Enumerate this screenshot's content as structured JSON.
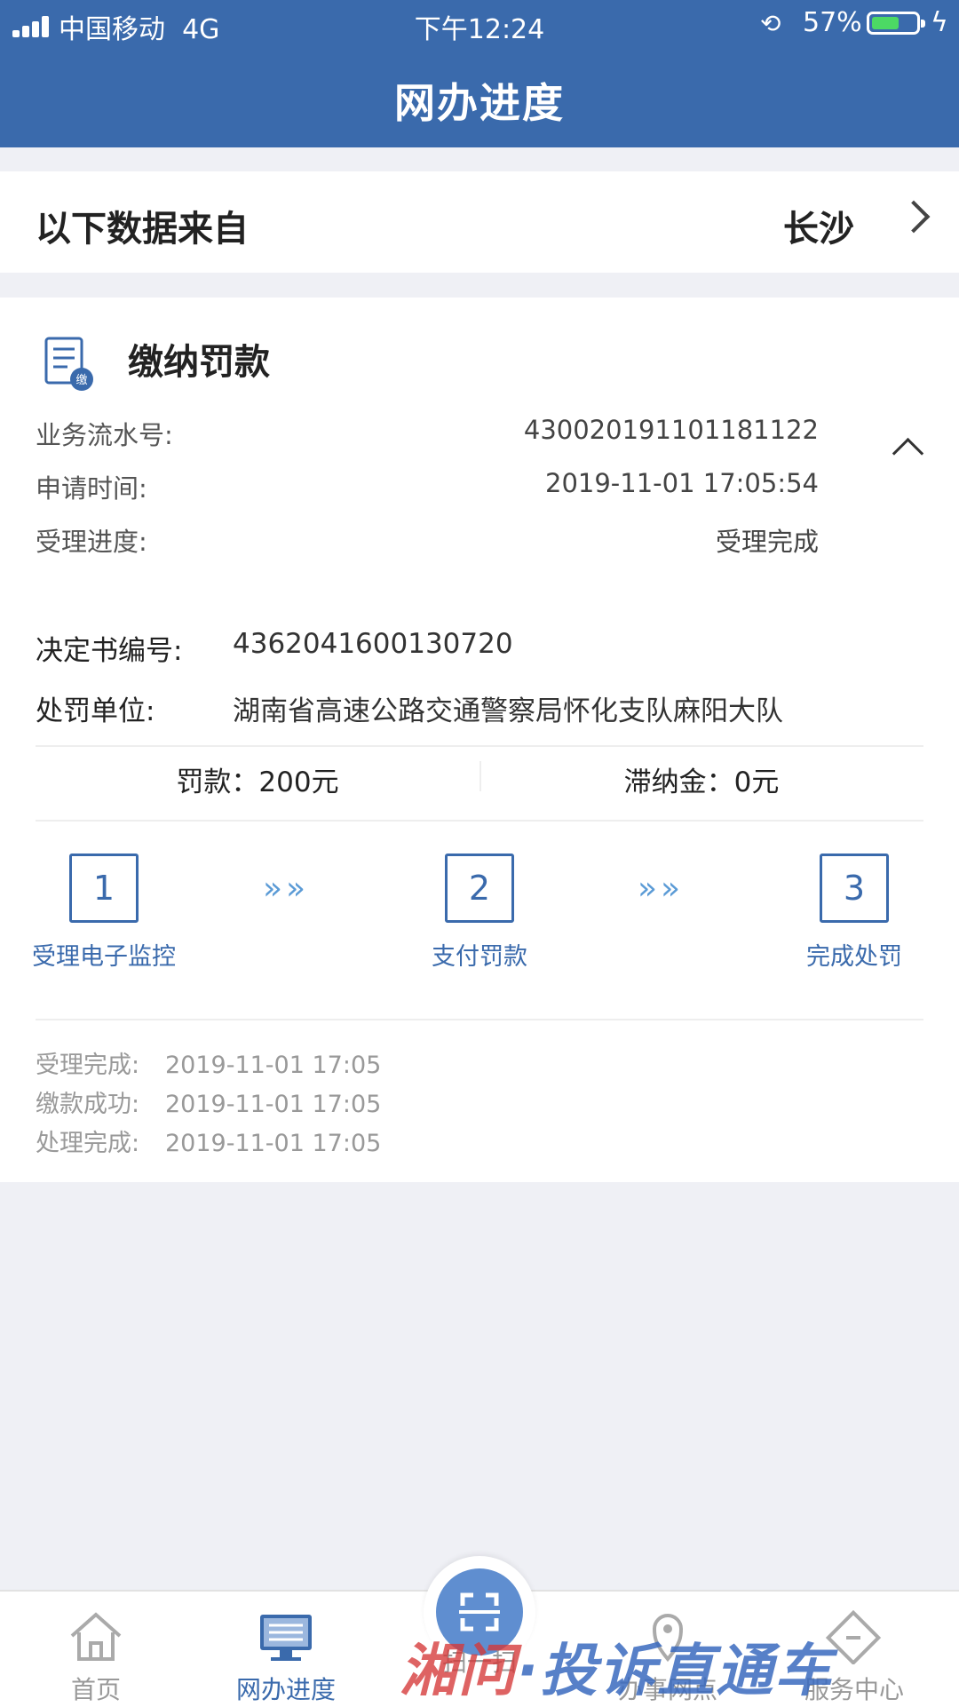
{
  "status": {
    "carrier": "中国移动",
    "network": "4G",
    "time": "下午12:24",
    "battery": "57%",
    "battery_level": 0.57
  },
  "header": {
    "title": "网办进度"
  },
  "source": {
    "label": "以下数据来自",
    "city": "长沙"
  },
  "card": {
    "title": "缴纳罚款",
    "icon_badge": "缴",
    "serial_label": "业务流水号:",
    "serial_value": "430020191101181122",
    "apply_time_label": "申请时间:",
    "apply_time_value": "2019-11-01 17:05:54",
    "progress_label": "受理进度:",
    "progress_value": "受理完成",
    "decision_label": "决定书编号:",
    "decision_value": "4362041600130720",
    "unit_label": "处罚单位:",
    "unit_value": "湖南省高速公路交通警察局怀化支队麻阳大队",
    "fine": "罚款：200元",
    "late_fee": "滞纳金：0元",
    "steps": [
      {
        "num": "1",
        "label": "受理电子监控"
      },
      {
        "num": "2",
        "label": "支付罚款"
      },
      {
        "num": "3",
        "label": "完成处罚"
      }
    ],
    "logs": [
      {
        "label": "受理完成:",
        "time": "2019-11-01 17:05"
      },
      {
        "label": "缴款成功:",
        "time": "2019-11-01 17:05"
      },
      {
        "label": "处理完成:",
        "time": "2019-11-01 17:05"
      }
    ]
  },
  "tabs": [
    {
      "label": "首页",
      "icon": "home-icon"
    },
    {
      "label": "网办进度",
      "icon": "monitor-icon"
    },
    {
      "label": "扫一扫",
      "icon": "scan-icon"
    },
    {
      "label": "办事网点",
      "icon": "location-pin-icon"
    },
    {
      "label": "服务中心",
      "icon": "service-center-icon"
    }
  ],
  "colors": {
    "brand": "#3a6aac",
    "background": "#eff0f5",
    "battery": "#4cd964"
  },
  "watermark": {
    "text_red": "湘问",
    "text_blue": "·投诉直通车"
  }
}
